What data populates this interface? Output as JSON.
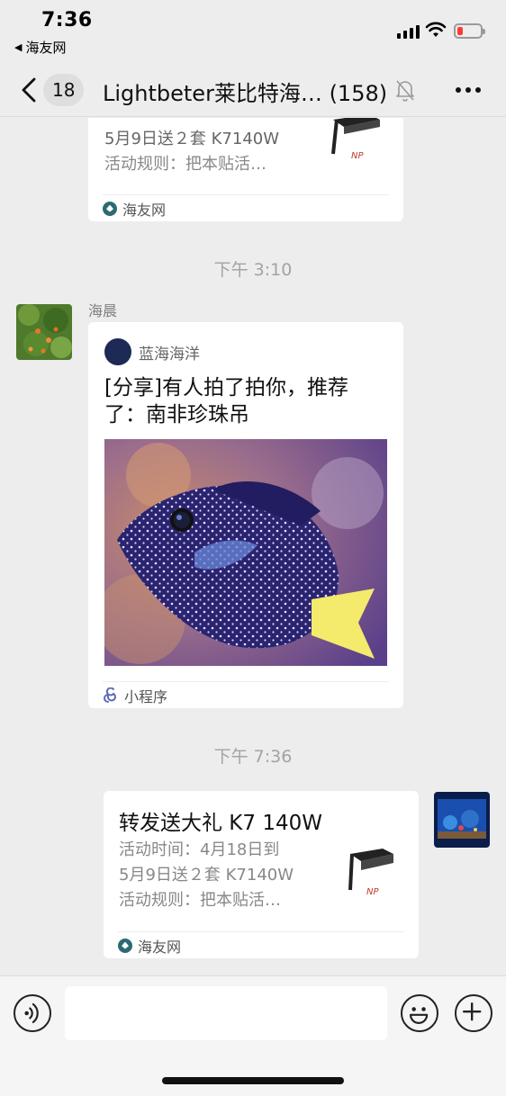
{
  "status_bar": {
    "time": "7:36",
    "back_app": "海友网",
    "battery_color": "#ff3b30"
  },
  "nav": {
    "unread_count": "18",
    "title": "Lightbeter莱比特海… (158)",
    "icons": {
      "back": "chevron-left-icon",
      "mute": "bell-off-icon",
      "more": "ellipsis-icon"
    }
  },
  "messages": [
    {
      "kind": "link",
      "desc_lines": [
        "5月9日送２套 K7140W",
        "活动规则：把本贴活…"
      ],
      "source": "海友网"
    },
    {
      "kind": "timestamp",
      "text": "下午 3:10"
    },
    {
      "kind": "mini_program",
      "sender": "海晨",
      "from": "蓝海海洋",
      "title": "[分享]有人拍了拍你，推荐了：南非珍珠吊",
      "footer": "小程序"
    },
    {
      "kind": "timestamp",
      "text": "下午 7:36"
    },
    {
      "kind": "link",
      "title": "转发送大礼 K7 140W",
      "desc_lines": [
        "活动时间：4月18日到",
        "5月9日送２套 K7140W",
        "活动规则：把本贴活…"
      ],
      "source": "海友网"
    }
  ],
  "input_bar": {
    "placeholder": "",
    "icons": {
      "voice": "voice-icon",
      "emoji": "emoji-icon",
      "plus": "plus-icon"
    }
  },
  "colors": {
    "background": "#ededed",
    "bubble": "#ffffff",
    "timestamp": "#a3a3a3"
  }
}
